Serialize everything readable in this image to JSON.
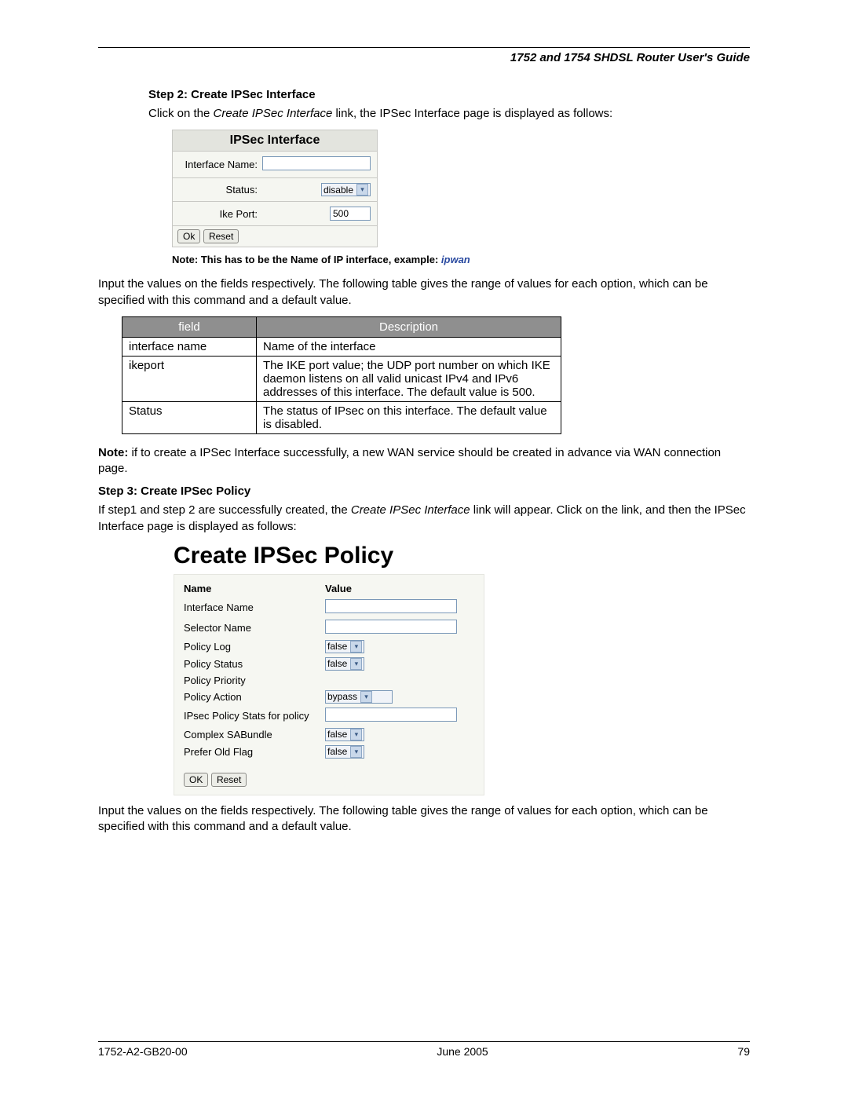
{
  "header": {
    "title": "1752 and 1754 SHDSL Router User's Guide"
  },
  "step2": {
    "heading": "Step 2: Create IPSec Interface",
    "intro_before": "Click on the ",
    "intro_link": "Create IPSec Interface",
    "intro_after": " link, the IPSec Interface page is displayed as follows:"
  },
  "panel1": {
    "title": "IPSec Interface",
    "rows": {
      "iface_label": "Interface Name:",
      "iface_value": "",
      "status_label": "Status:",
      "status_value": "disable",
      "ike_label": "Ike Port:",
      "ike_value": "500"
    },
    "buttons": {
      "ok": "Ok",
      "reset": "Reset"
    }
  },
  "note1": {
    "prefix": "Note: This has to be the Name of IP interface, example: ",
    "example": "ipwan"
  },
  "para_after_panel1": "Input the values on the fields respectively. The following table gives the range of values for each option, which can be specified with this command and a default value.",
  "desc_table": {
    "head": {
      "field": "field",
      "desc": "Description"
    },
    "rows": [
      {
        "field": "interface name",
        "desc": "Name of the interface"
      },
      {
        "field": "ikeport",
        "desc": "The IKE port value; the UDP port number on which IKE daemon listens on all valid unicast IPv4 and IPv6 addresses of this interface. The default value is 500."
      },
      {
        "field": "Status",
        "desc": "The status of IPsec on this interface. The default value is disabled."
      }
    ]
  },
  "note2_before": "Note:",
  "note2_after": " if to create a IPSec Interface successfully, a new WAN service should be created in advance via WAN connection page.",
  "step3": {
    "heading": "Step 3: Create IPSec Policy",
    "intro_before": "If step1 and step 2 are successfully created, the ",
    "intro_link": "Create IPSec Interface",
    "intro_after": " link will appear. Click on the link, and then the IPSec Interface page is displayed as follows:"
  },
  "policy_title": "Create IPSec Policy",
  "panel2": {
    "head": {
      "name": "Name",
      "value": "Value"
    },
    "rows": [
      {
        "label": "Interface Name",
        "type": "text",
        "value": ""
      },
      {
        "label": "Selector Name",
        "type": "text",
        "value": ""
      },
      {
        "label": "Policy Log",
        "type": "select",
        "value": "false"
      },
      {
        "label": "Policy Status",
        "type": "select",
        "value": "false"
      },
      {
        "label": "Policy Priority",
        "type": "none",
        "value": ""
      },
      {
        "label": "Policy Action",
        "type": "select-wide",
        "value": "bypass"
      },
      {
        "label": "IPsec Policy Stats for policy",
        "type": "text",
        "value": ""
      },
      {
        "label": "Complex SABundle",
        "type": "select",
        "value": "false"
      },
      {
        "label": "Prefer Old Flag",
        "type": "select",
        "value": "false"
      }
    ],
    "buttons": {
      "ok": "OK",
      "reset": "Reset"
    }
  },
  "para_after_panel2": "Input the values on the fields respectively. The following table gives the range of values for each option, which can be specified with this command and a default value.",
  "footer": {
    "left": "1752-A2-GB20-00",
    "center": "June 2005",
    "right": "79"
  }
}
